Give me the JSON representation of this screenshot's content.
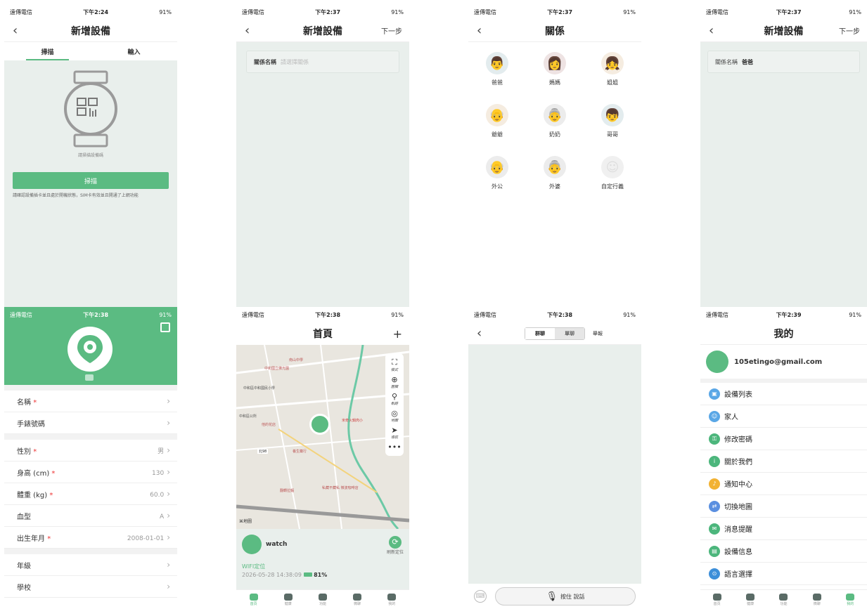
{
  "status": {
    "carrier": "遠傳電信",
    "battery": "91%",
    "t1": "下午2:24",
    "t2": "下午2:37",
    "t3": "下午2:37",
    "t4": "下午2:37",
    "t5": "下午2:38",
    "t6": "下午2:38",
    "t7": "下午2:38",
    "t8": "下午2:39"
  },
  "s1": {
    "title": "新增設備",
    "tab_scan": "掃描",
    "tab_input": "輸入",
    "scan_hint": "請掃描設備碼",
    "scan_button": "掃描",
    "note": "請確認設備插卡並且處於開機狀態，SIM卡有效並且開通了上網功能"
  },
  "s2": {
    "title": "新增設備",
    "next": "下一步",
    "field_label": "關係名稱",
    "field_placeholder": "請選擇關係"
  },
  "s3": {
    "title": "關係",
    "relations": [
      "爸爸",
      "媽媽",
      "姐姐",
      "爺爺",
      "奶奶",
      "哥哥",
      "外公",
      "外婆",
      "自定行義"
    ]
  },
  "s4": {
    "title": "新增設備",
    "next": "下一步",
    "field_label": "關係名稱",
    "field_value": "爸爸"
  },
  "s5": {
    "rows": [
      {
        "label": "名稱",
        "required": "*",
        "value": ""
      },
      {
        "label": "手錶號碼",
        "required": "",
        "value": ""
      },
      {
        "label": "性別",
        "required": "*",
        "value": "男"
      },
      {
        "label": "身高 (cm)",
        "required": "*",
        "value": "130"
      },
      {
        "label": "體重 (kg)",
        "required": "*",
        "value": "60.0"
      },
      {
        "label": "血型",
        "required": "",
        "value": "A"
      },
      {
        "label": "出生年月",
        "required": "*",
        "value": "2008-01-01"
      },
      {
        "label": "年級",
        "required": "",
        "value": ""
      },
      {
        "label": "學校",
        "required": "",
        "value": ""
      }
    ]
  },
  "s6": {
    "title": "首頁",
    "add": "+",
    "side": [
      "模式",
      "圍欄",
      "軌跡",
      "地圖",
      "導航"
    ],
    "map_logo": "地圖",
    "device_name": "watch",
    "refresh": "刷新定位",
    "loc_type": "WIFI定位",
    "loc_time": "2026-05-28 14:38:09",
    "battery": "81%",
    "map_labels": [
      "南山中學",
      "中和國立佛光園",
      "中和區中和國民小學",
      "中和區公所",
      "他的花店",
      "米奇火鍋肉小",
      "養生藥行",
      "翻轉拉麵",
      "私藏不藏私 微波咖啡店",
      "北98"
    ],
    "tabs": [
      "首頁",
      "健康",
      "功能",
      "微聊",
      "我的"
    ]
  },
  "s7": {
    "tab_group": "群聊",
    "tab_single": "單聊",
    "report": "舉報",
    "hold": "按住 說話"
  },
  "s8": {
    "title": "我的",
    "email": "105etingo@gmail.com",
    "menu": [
      "設備列表",
      "家人",
      "修改密碼",
      "關於我們",
      "通知中心",
      "切換地圖",
      "消息提醒",
      "設備信息",
      "語言選擇"
    ],
    "menu_colors": [
      "#5aa7e6",
      "#5aa7e6",
      "#4cb67c",
      "#4cb67c",
      "#f2b233",
      "#5a8fe0",
      "#4cb67c",
      "#4cb67c",
      "#3d8fd9"
    ],
    "tabs": [
      "首頁",
      "健康",
      "功能",
      "微聊",
      "我的"
    ]
  },
  "colors": {
    "accent": "#5bbb82"
  }
}
